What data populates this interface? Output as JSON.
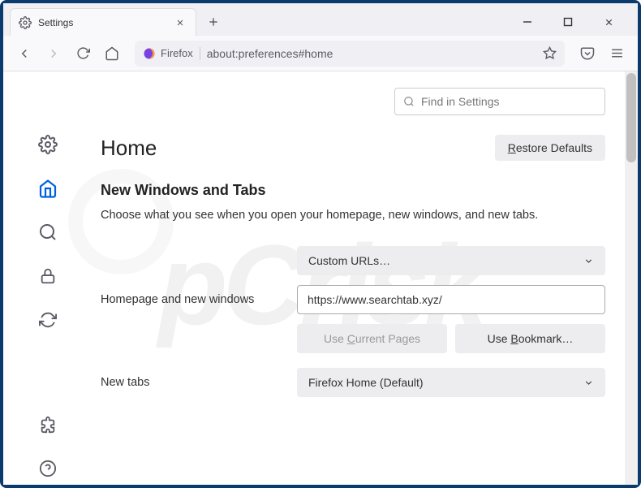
{
  "tab": {
    "title": "Settings"
  },
  "url": {
    "identity": "Firefox",
    "path": "about:preferences#home"
  },
  "search": {
    "placeholder": "Find in Settings"
  },
  "page": {
    "title": "Home",
    "restore_label": "Restore Defaults"
  },
  "section": {
    "title": "New Windows and Tabs",
    "desc": "Choose what you see when you open your homepage, new windows, and new tabs."
  },
  "form": {
    "homepage_label": "Homepage and new windows",
    "homepage_mode": "Custom URLs…",
    "homepage_url": "https://www.searchtab.xyz/",
    "use_current": "Use Current Pages",
    "use_bookmark": "Use Bookmark…",
    "newtabs_label": "New tabs",
    "newtabs_mode": "Firefox Home (Default)"
  }
}
